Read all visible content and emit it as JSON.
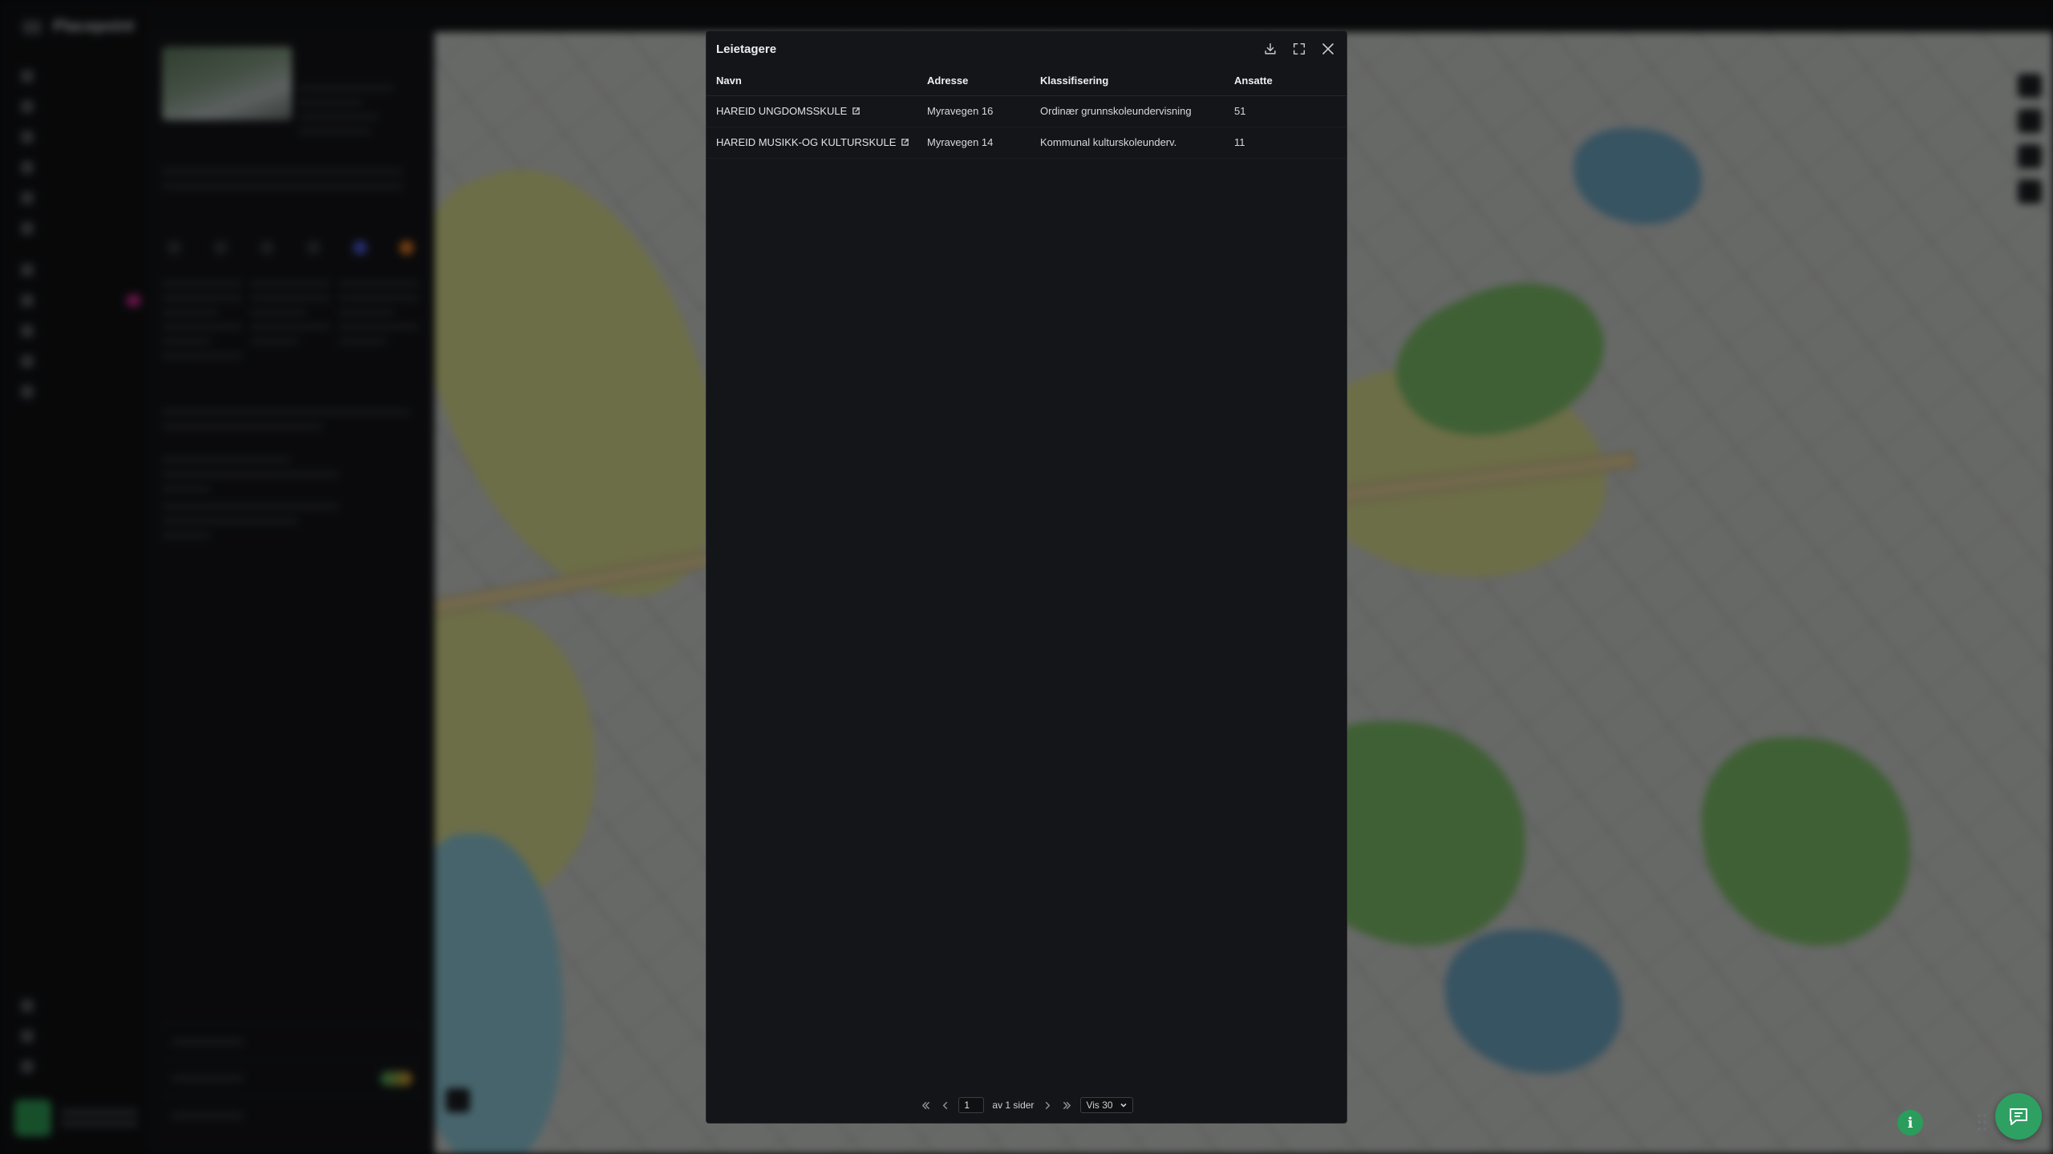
{
  "background": {
    "app_name": "Placepoint"
  },
  "modal": {
    "title": "Leietagere",
    "columns": [
      "Navn",
      "Adresse",
      "Klassifisering",
      "Ansatte"
    ],
    "rows": [
      {
        "navn": "HAREID UNGDOMSSKULE",
        "adresse": "Myravegen 16",
        "klassifisering": "Ordinær grunnskoleundervisning",
        "ansatte": "51"
      },
      {
        "navn": "HAREID MUSIKK-OG KULTURSKULE",
        "adresse": "Myravegen 14",
        "klassifisering": "Kommunal kulturskoleunderv.",
        "ansatte": "11"
      }
    ],
    "pagination": {
      "current_page": "1",
      "page_count_label": "av 1 sider",
      "page_size_label": "Vis 30"
    }
  },
  "icons": {
    "download": "download-icon",
    "expand": "expand-icon",
    "close": "close-icon",
    "external": "external-link-icon",
    "chat": "chat-icon",
    "info": "info-icon"
  },
  "colors": {
    "modal_bg": "#141518",
    "accent_green": "#2ea162"
  }
}
